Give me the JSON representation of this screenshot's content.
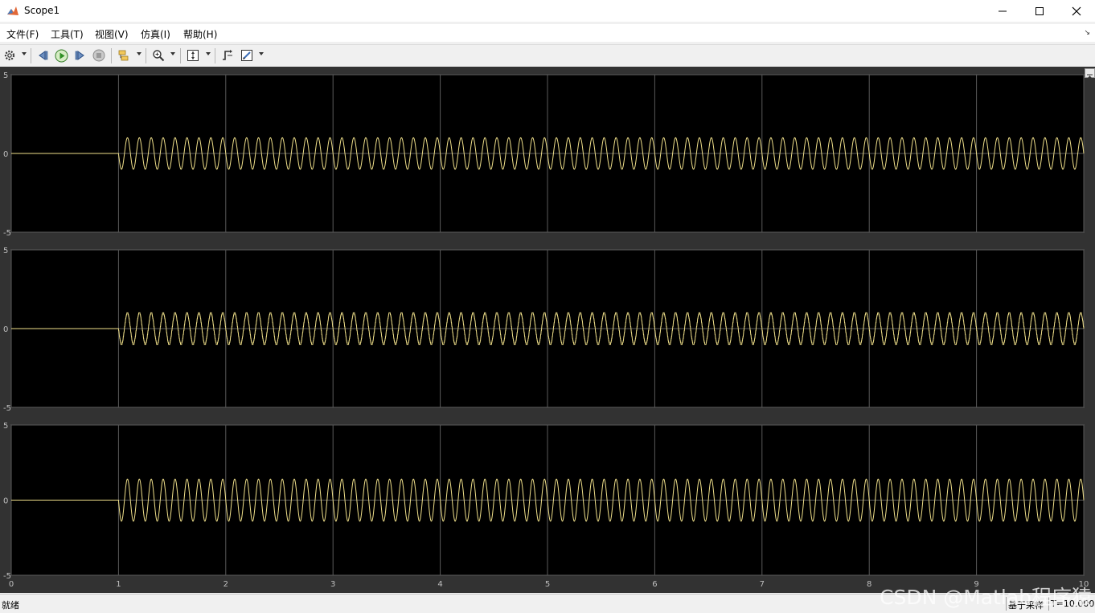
{
  "window": {
    "title": "Scope1"
  },
  "menu": [
    "文件(F)",
    "工具(T)",
    "视图(V)",
    "仿真(I)",
    "帮助(H)"
  ],
  "toolbar": {
    "icons": [
      "gear-icon",
      "step-back-icon",
      "run-icon",
      "step-forward-icon",
      "stop-icon",
      "signal-select-icon",
      "zoom-icon",
      "scale-axes-icon",
      "triggers-icon",
      "highlight-icon"
    ]
  },
  "colors": {
    "plot_bg": "#000000",
    "frame_bg": "#323232",
    "grid": "#5a5a5a",
    "trace": "#f0e08a",
    "axis_text": "#bfbfbf"
  },
  "chart_data": [
    {
      "type": "line",
      "xlim": [
        0,
        10
      ],
      "ylim": [
        -5,
        5
      ],
      "xticks": [
        "0",
        "1",
        "2",
        "3",
        "4",
        "5",
        "6",
        "7",
        "8",
        "9",
        "10"
      ],
      "yticks": [
        "5",
        "0",
        "-5"
      ],
      "grid": true,
      "series": [
        {
          "start": 1,
          "amplitude": 1.0,
          "cycles_per_unit": 9,
          "phase": 3.14159,
          "x_tick_labels_shown": false
        }
      ]
    },
    {
      "type": "line",
      "xlim": [
        0,
        10
      ],
      "ylim": [
        -5,
        5
      ],
      "xticks": [
        "0",
        "1",
        "2",
        "3",
        "4",
        "5",
        "6",
        "7",
        "8",
        "9",
        "10"
      ],
      "yticks": [
        "5",
        "0",
        "-5"
      ],
      "grid": true,
      "series": [
        {
          "start": 1,
          "amplitude": 1.0,
          "cycles_per_unit": 9,
          "phase": 3.14159,
          "stepped": true
        }
      ]
    },
    {
      "type": "line",
      "xlim": [
        0,
        10
      ],
      "ylim": [
        -5,
        5
      ],
      "xticks": [
        "0",
        "1",
        "2",
        "3",
        "4",
        "5",
        "6",
        "7",
        "8",
        "9",
        "10"
      ],
      "yticks": [
        "5",
        "0",
        "-5"
      ],
      "grid": true,
      "series": [
        {
          "start": 1,
          "amplitude": 1.4,
          "cycles_per_unit": 9,
          "phase": 3.14159
        }
      ]
    }
  ],
  "status": {
    "left": "就绪",
    "sample": "基于采样",
    "time": "T=10.000"
  },
  "watermark": "CSDN @Matlab程序猿"
}
